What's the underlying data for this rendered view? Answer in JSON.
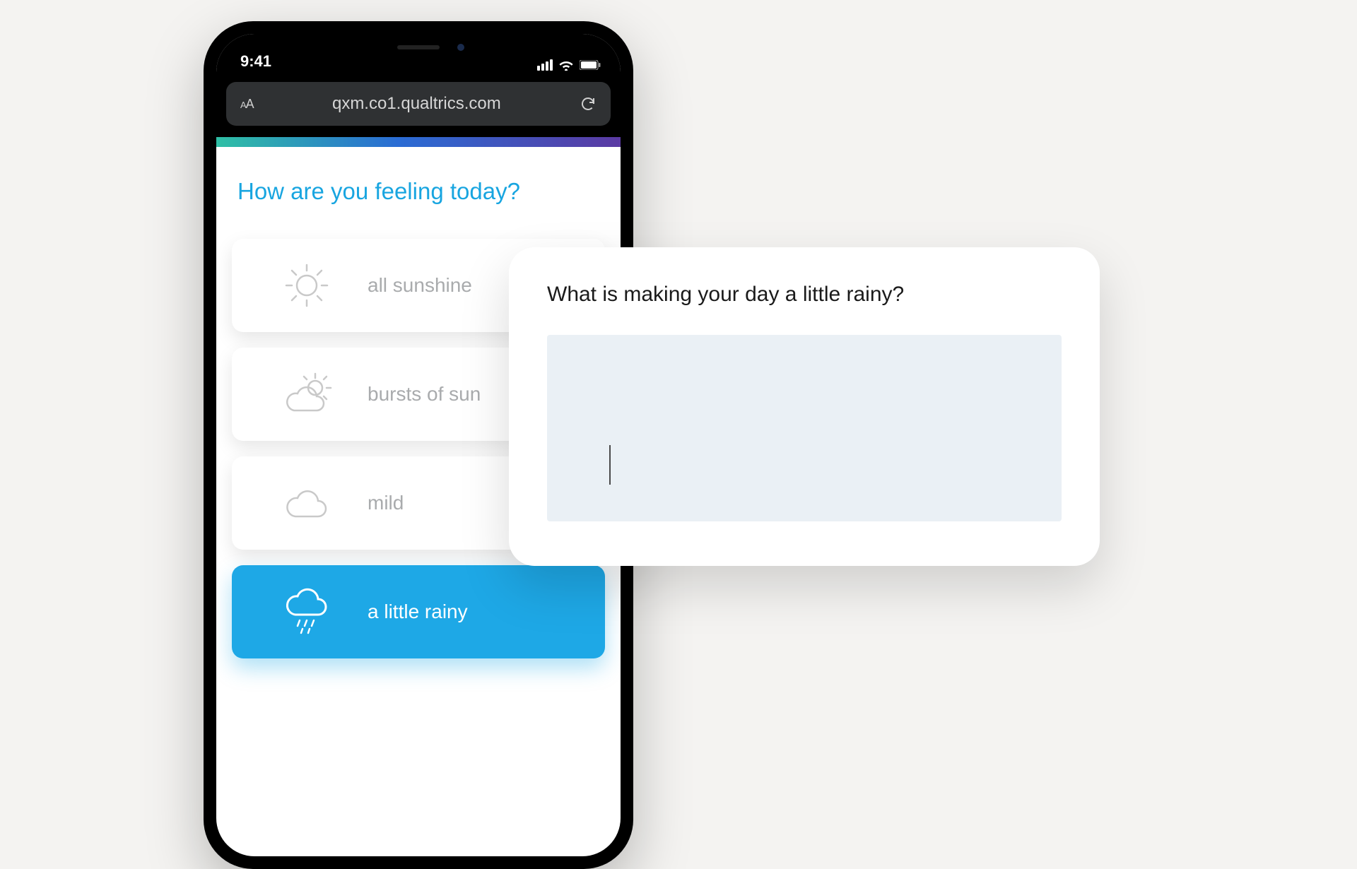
{
  "status": {
    "time": "9:41"
  },
  "browser": {
    "url": "qxm.co1.qualtrics.com"
  },
  "survey": {
    "question": "How are you feeling today?",
    "options": [
      {
        "label": "all sunshine",
        "icon": "sun",
        "selected": false
      },
      {
        "label": "bursts of sun",
        "icon": "sun-cloud",
        "selected": false
      },
      {
        "label": "mild",
        "icon": "cloud",
        "selected": false
      },
      {
        "label": "a little rainy",
        "icon": "rain",
        "selected": true
      }
    ]
  },
  "popup": {
    "question": "What is making your day a little rainy?",
    "value": ""
  },
  "colors": {
    "accent": "#1ea8e6",
    "title": "#18a5e0"
  }
}
